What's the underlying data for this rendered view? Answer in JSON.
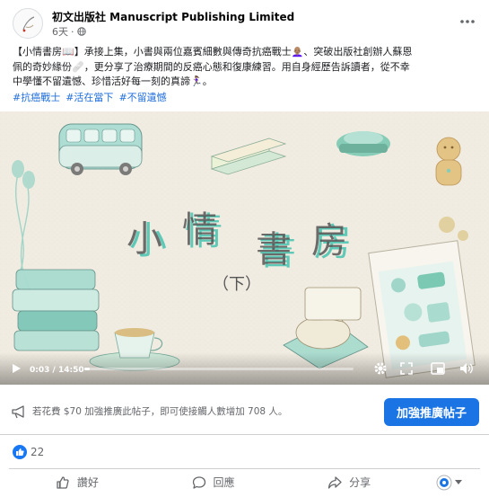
{
  "post": {
    "author": "初文出版社 Manuscript Publishing Limited",
    "time": "6天",
    "meta_separator": "·",
    "text_line1": "【小情書房📖】承接上集，小書與兩位嘉賓細數與傳奇抗癌戰士👩🏽‍🦲、突破出版社創辦人蘇恩",
    "text_line2": "佩的奇妙緣份🩹，更分享了治療期間的反癌心態和復康練習。用自身經歷告訴讀者，從不幸",
    "text_line3": "中學懂不留遺憾、珍惜活好每一刻的真諦🏃🏽‍♀️。",
    "hashtags": [
      "#抗癌戰士",
      "#活在當下",
      "#不留遺憾"
    ]
  },
  "video": {
    "title_chars": [
      "小",
      "情",
      "書",
      "房"
    ],
    "subtitle": "（下）",
    "current_time": "0:03",
    "duration": "14:50",
    "time_separator": " / ",
    "progress": 0.0034
  },
  "boost": {
    "text": "若花費 $70 加強推廣此帖子，即可使接觸人數增加 708 人。",
    "button_label": "加強推廣帖子"
  },
  "reactions": {
    "count": "22"
  },
  "actions": {
    "like": "讚好",
    "comment": "回應",
    "share": "分享"
  },
  "colors": {
    "accent": "#1b74e4",
    "like_blue": "#1877f2",
    "hashtag": "#216fdb",
    "title_teal": "#5ec9b6"
  },
  "icons": [
    "globe-icon",
    "more-horizontal-icon",
    "play-icon",
    "volume-icon",
    "settings-icon",
    "fullscreen-icon",
    "megaphone-icon",
    "thumbs-up-icon",
    "comment-icon",
    "share-icon",
    "caret-down-icon"
  ]
}
